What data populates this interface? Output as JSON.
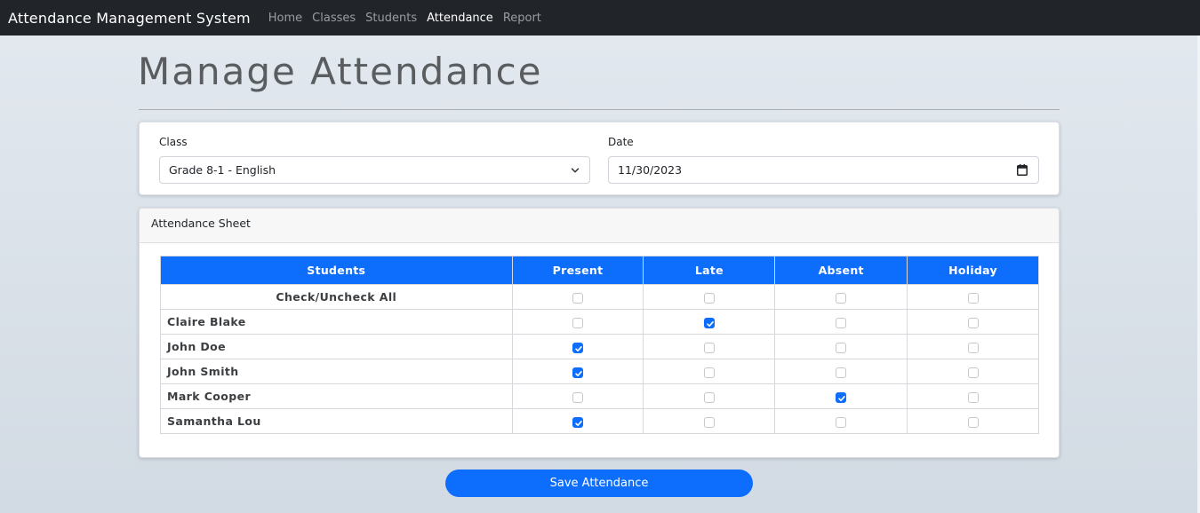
{
  "nav": {
    "brand": "Attendance Management System",
    "links": [
      {
        "label": "Home",
        "active": false
      },
      {
        "label": "Classes",
        "active": false
      },
      {
        "label": "Students",
        "active": false
      },
      {
        "label": "Attendance",
        "active": true
      },
      {
        "label": "Report",
        "active": false
      }
    ]
  },
  "page": {
    "title": "Manage Attendance"
  },
  "filters": {
    "class_label": "Class",
    "class_value": "Grade 8-1 - English",
    "date_label": "Date",
    "date_value": "11/30/2023"
  },
  "sheet": {
    "title": "Attendance Sheet",
    "columns": [
      "Students",
      "Present",
      "Late",
      "Absent",
      "Holiday"
    ],
    "check_all_label": "Check/Uncheck All",
    "rows": [
      {
        "name": "Claire Blake",
        "status": "Late"
      },
      {
        "name": "John Doe",
        "status": "Present"
      },
      {
        "name": "John Smith",
        "status": "Present"
      },
      {
        "name": "Mark Cooper",
        "status": "Absent"
      },
      {
        "name": "Samantha Lou",
        "status": "Present"
      }
    ]
  },
  "actions": {
    "save_label": "Save Attendance"
  },
  "colors": {
    "accent": "#0d6efd",
    "navbar": "#212529"
  },
  "icons": {
    "select": "chevron-down-icon",
    "date": "calendar-icon",
    "check": "check-icon"
  }
}
